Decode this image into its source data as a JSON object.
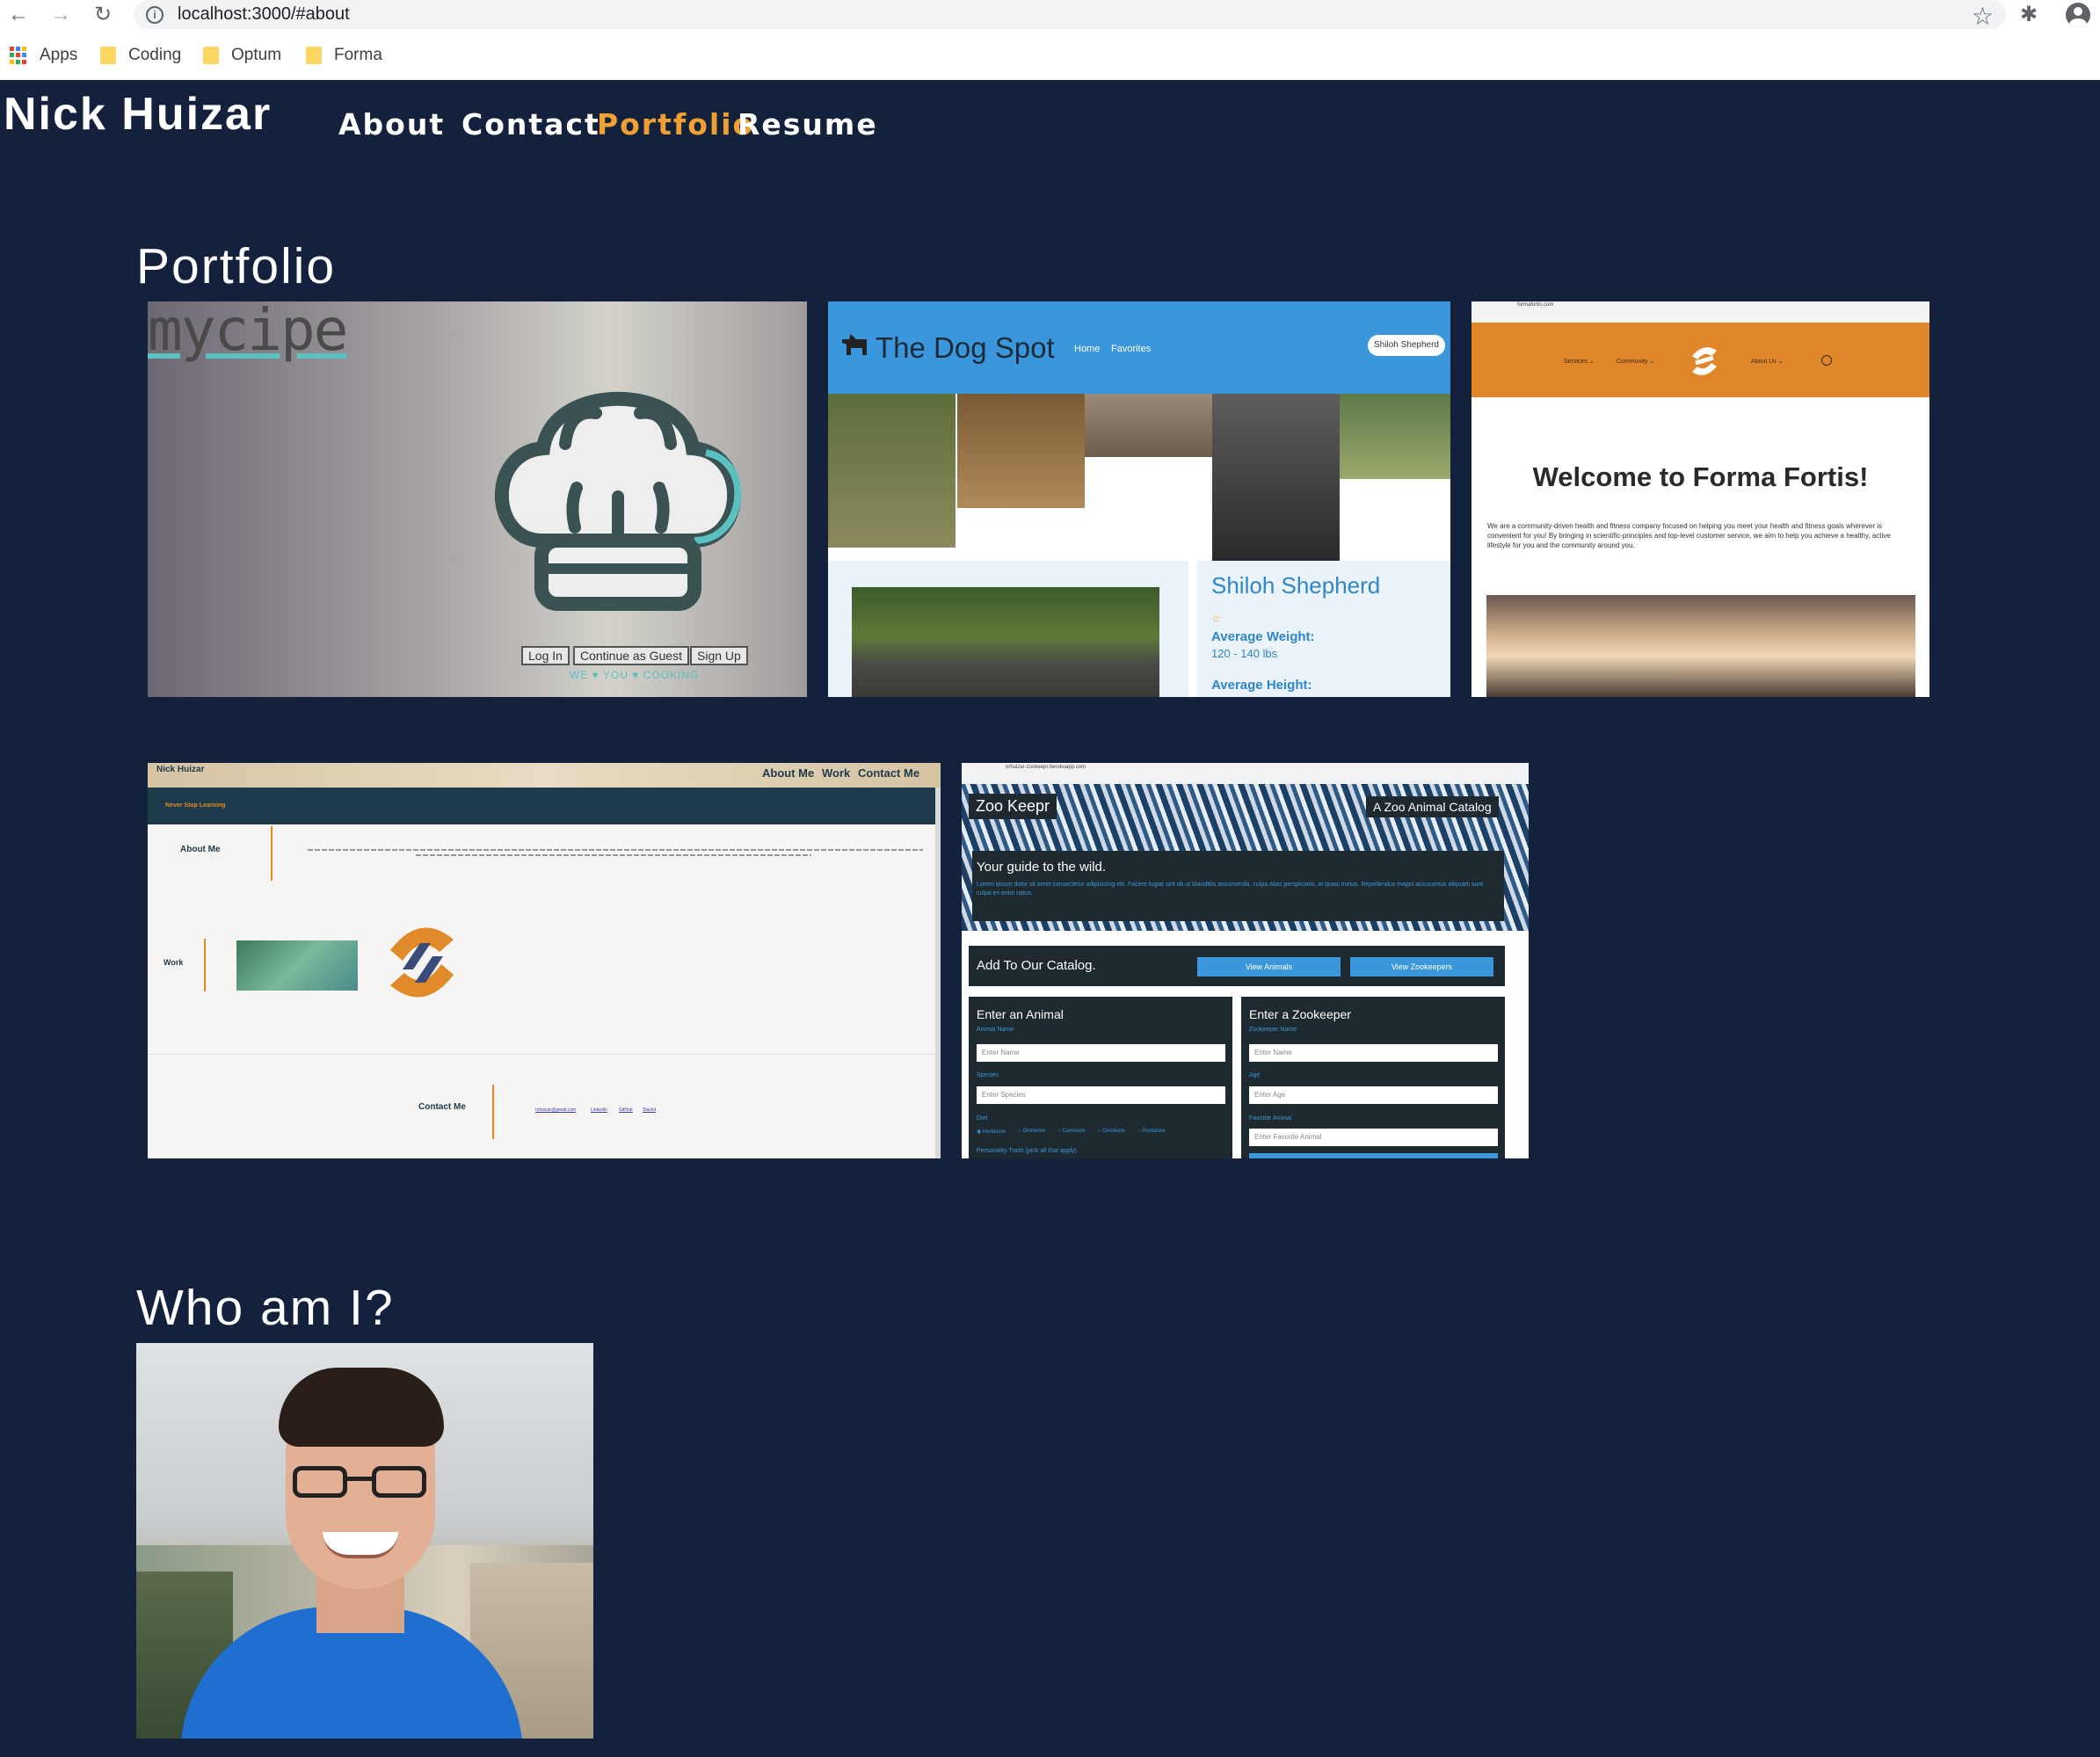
{
  "browser": {
    "url": "localhost:3000/#about",
    "bookmarks": [
      "Apps",
      "Coding",
      "Optum",
      "Forma"
    ]
  },
  "site": {
    "title": "Nick Huizar",
    "nav": [
      "About",
      "Contact",
      "Portfolio",
      "Resume"
    ],
    "active_nav": "Portfolio"
  },
  "portfolio": {
    "heading": "Portfolio",
    "mycipe": {
      "logo": "mycipe",
      "buttons": [
        "Log In",
        "Continue as Guest",
        "Sign Up"
      ],
      "tagline": "WE ♥ YOU ♥ COOKING"
    },
    "dogspot": {
      "title": "The Dog Spot",
      "nav": [
        "Home",
        "Favorites"
      ],
      "search_value": "Shiloh Shepherd",
      "breed": "Shiloh Shepherd",
      "weight_label": "Average Weight:",
      "weight_value": "120 - 140 lbs",
      "height_label": "Average Height:"
    },
    "forma": {
      "address": "formafortis.com",
      "menu": [
        "Services ⌄",
        "Community ⌄",
        "About Us ⌄"
      ],
      "heading": "Welcome to Forma Fortis!",
      "body": "We are a community-driven health and fitness company focused on helping you meet your health and fitness goals wherever is convenient for you! By bringing in scientific-principles and top-level customer service, we aim to help you achieve a healthy, active lifestyle for you and the community around you."
    },
    "portfolio_site": {
      "name": "Nick Huizar",
      "nav": [
        "About Me",
        "Work",
        "Contact Me"
      ],
      "banner": "Never Stop Learning",
      "about_label": "About Me",
      "work_label": "Work",
      "contact_label": "Contact Me",
      "contact_links": [
        "nrhuizar@gmail.com",
        "LinkedIn",
        "GitHub",
        "Stackit"
      ]
    },
    "zookeepr": {
      "address": "nrhuizar-zookeepr.herokuapp.com",
      "title": "Zoo Keepr",
      "catalog": "A Zoo Animal Catalog",
      "guide": "Your guide to the wild.",
      "lorem": "Lorem ipsum dolor sit amet consectetur adipisicing elit. Facere fugiat sint ab ut blanditiis assumenda, culpa alias perspiciatis, at quasi minus. Repellendus magni accusamus aliquam sunt culpa ex enim natus.",
      "add_title": "Add To Our Catalog.",
      "btn_animals": "View Animals",
      "btn_zookeepers": "View Zookeepers",
      "animal_title": "Enter an Animal",
      "animal_name_label": "Animal Name",
      "animal_name_ph": "Enter Name",
      "species_label": "Species",
      "species_ph": "Enter Species",
      "diet_label": "Diet",
      "diets": [
        "Herbivore",
        "Omnivore",
        "Carnivore",
        "Omnivore",
        "Predatore"
      ],
      "traits_label": "Personality Traits (pick all that apply)",
      "keeper_title": "Enter a Zookeeper",
      "keeper_name_label": "Zookeeper Name",
      "keeper_name_ph": "Enter Name",
      "age_label": "Age",
      "age_ph": "Enter Age",
      "fav_label": "Favorite Animal",
      "fav_ph": "Enter Favorite Animal"
    }
  },
  "about": {
    "heading": "Who am I?"
  },
  "colors": {
    "page_bg": "#13213d",
    "accent": "#f0a030",
    "dogspot_blue": "#3a97db",
    "forma_orange": "#e0862b"
  }
}
